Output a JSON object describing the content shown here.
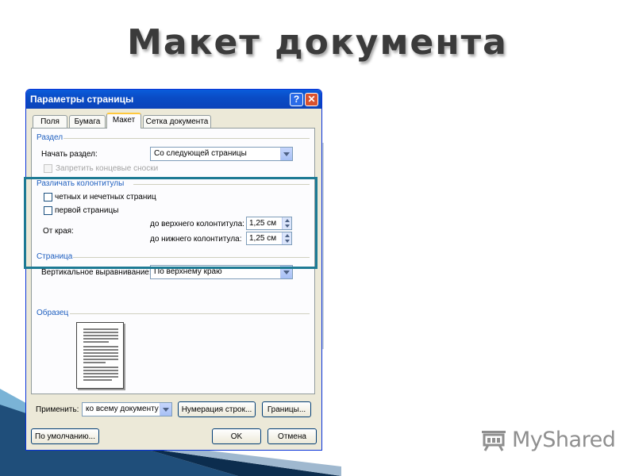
{
  "slide": {
    "title": "Макет документа"
  },
  "watermark": {
    "text": "MyShared"
  },
  "dialog": {
    "title": "Параметры страницы",
    "help_glyph": "?",
    "close_glyph": "✕",
    "tabs": [
      "Поля",
      "Бумага",
      "Макет",
      "Сетка документа"
    ],
    "active_tab": "Макет",
    "section_group": {
      "label": "Раздел",
      "start_label": "Начать раздел:",
      "start_value": "Со следующей страницы",
      "suppress_endnotes_label": "Запретить концевые сноски"
    },
    "headers_group": {
      "label": "Различать колонтитулы",
      "odd_even_label": "четных и нечетных страниц",
      "first_page_label": "первой страницы",
      "from_edge_label": "От края:",
      "header_label": "до верхнего колонтитула:",
      "header_value": "1,25 см",
      "footer_label": "до нижнего колонтитула:",
      "footer_value": "1,25 см"
    },
    "page_group": {
      "label": "Страница",
      "vertical_align_label": "Вертикальное выравнивание:",
      "vertical_align_value": "По верхнему краю"
    },
    "preview_group": {
      "label": "Образец"
    },
    "apply": {
      "label": "Применить:",
      "value": "ко всему документу",
      "line_numbers_button": "Нумерация строк...",
      "borders_button": "Границы..."
    },
    "footer": {
      "default_button": "По умолчанию...",
      "ok_button": "OK",
      "cancel_button": "Отмена"
    }
  }
}
